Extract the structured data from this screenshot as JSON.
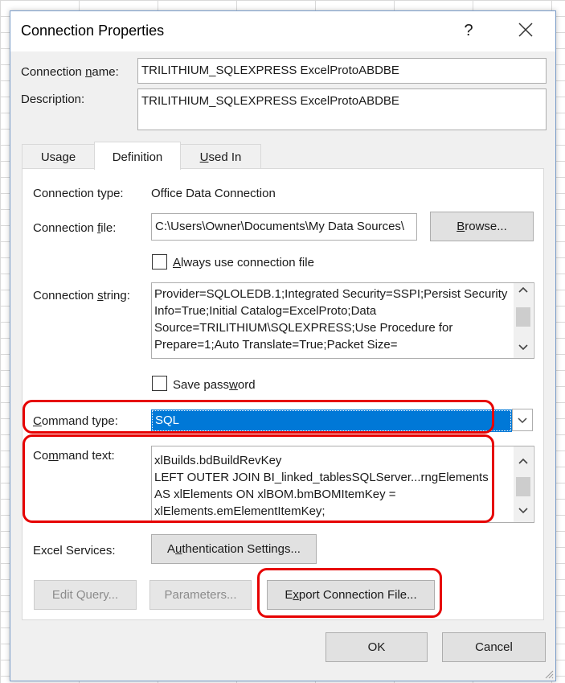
{
  "dialog": {
    "title": "Connection Properties",
    "help_label": "?",
    "connection_name_label_pre": "Connection ",
    "connection_name_label_ul": "n",
    "connection_name_label_post": "ame:",
    "connection_name_value": "TRILITHIUM_SQLEXPRESS ExcelProtoABDBE",
    "description_label": "Description:",
    "description_value": "TRILITHIUM_SQLEXPRESS ExcelProtoABDBE"
  },
  "tabs": {
    "usage": "Usage",
    "definition": "Definition",
    "used_in_ul": "U",
    "used_in_rest": "sed In",
    "active": "Definition"
  },
  "definition": {
    "connection_type_label": "Connection type:",
    "connection_type_value": "Office Data Connection",
    "connection_file_label_pre": "Connection ",
    "connection_file_label_ul": "f",
    "connection_file_label_post": "ile:",
    "connection_file_value": "C:\\Users\\Owner\\Documents\\My Data Sources\\",
    "browse_ul": "B",
    "browse_rest": "rowse...",
    "always_use_ul": "A",
    "always_use_rest": "lways use connection file",
    "always_use_checked": false,
    "connection_string_label_pre": "Connection ",
    "connection_string_label_ul": "s",
    "connection_string_label_post": "tring:",
    "connection_string_value": "Provider=SQLOLEDB.1;Integrated Security=SSPI;Persist Security Info=True;Initial Catalog=ExcelProto;Data Source=TRILITHIUM\\SQLEXPRESS;Use Procedure for Prepare=1;Auto Translate=True;Packet Size=",
    "save_password_pre": "Save pass",
    "save_password_ul": "w",
    "save_password_post": "ord",
    "save_password_checked": false,
    "command_type_label_ul": "C",
    "command_type_label_rest": "ommand type:",
    "command_type_value": "SQL",
    "command_text_label_pre": "Co",
    "command_text_label_ul": "m",
    "command_text_label_post": "mand text:",
    "command_text_lines": [
      "xlBuilds.bdBuildRevKey",
      "LEFT OUTER JOIN BI_linked_tablesSQLServer...rngElements",
      "AS xlElements ON xlBOM.bmBOMItemKey =",
      "xlElements.emElementItemKey;"
    ],
    "excel_services_label": "Excel Services:",
    "auth_ul": "u",
    "auth_pre": "A",
    "auth_post": "thentication Settings...",
    "edit_query": "Edit Query...",
    "parameters": "Parameters...",
    "export_ul": "x",
    "export_pre": "E",
    "export_post": "port Connection File..."
  },
  "footer": {
    "ok": "OK",
    "cancel": "Cancel"
  },
  "colors": {
    "highlight": "#e60000",
    "selection": "#0078d7"
  }
}
